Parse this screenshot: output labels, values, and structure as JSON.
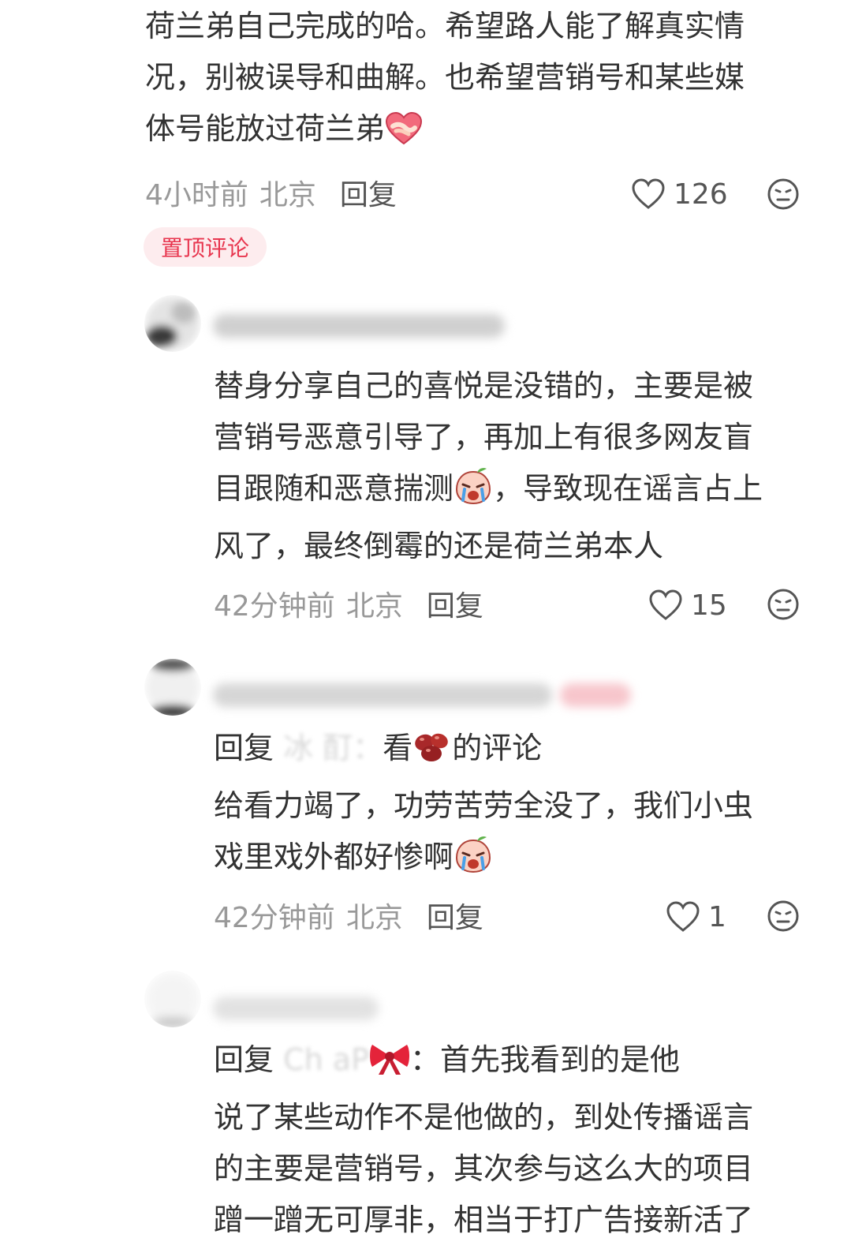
{
  "colors": {
    "text": "#333333",
    "meta": "#999999",
    "reply": "#555555",
    "pinned_bg": "#fdecee",
    "pinned_text": "#e8364f"
  },
  "comments": [
    {
      "lines": [
        "荷兰弟自己完成的哈。希望路人能了解真实情",
        "况，别被误导和曲解。也希望营销号和某些媒",
        "体号能放过荷兰弟"
      ],
      "emoji": "handshake-heart-emoji",
      "time": "4小时前",
      "location": "北京",
      "reply_label": "回复",
      "likes": "126",
      "pinned_label": "置顶评论"
    },
    {
      "lines": [
        "替身分享自己的喜悦是没错的，主要是被",
        "营销号恶意引导了，再加上有很多网友盲",
        "目跟随和恶意揣测",
        "，导致现在谣言占上",
        "风了，最终倒霉的还是荷兰弟本人"
      ],
      "emoji": "crying-peach-emoji",
      "time": "42分钟前",
      "location": "北京",
      "reply_label": "回复",
      "likes": "15"
    },
    {
      "reply_prefix": "回复",
      "reply_target": "冰                    酊：",
      "lines": [
        "看",
        "的评论",
        "给看力竭了，功劳苦劳全没了，我们小虫",
        "戏里戏外都好惨啊"
      ],
      "emoji_bean": "red-bean-emoji",
      "emoji_cry": "crying-peach-emoji",
      "time": "42分钟前",
      "location": "北京",
      "reply_label": "回复",
      "likes": "1"
    },
    {
      "reply_prefix": "回复",
      "reply_target": "Ch   aP",
      "reply_target_suffix": "：首先我看到的是他",
      "lines": [
        "说了某些动作不是他做的，到处传播谣言",
        "的主要是营销号，其次参与这么大的项目",
        "蹭一蹭无可厚非，相当于打广告接新活了"
      ],
      "emoji": "bow-emoji"
    }
  ]
}
